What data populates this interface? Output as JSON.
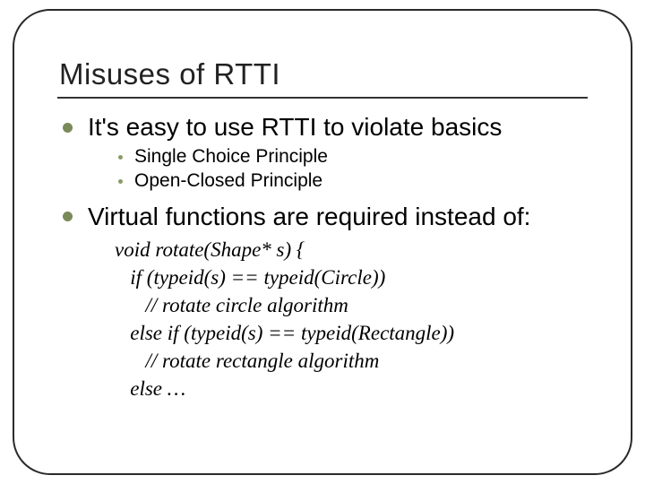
{
  "title": "Misuses of RTTI",
  "bullets": [
    {
      "text": "It's easy to use RTTI to violate basics",
      "sub": [
        "Single Choice Principle",
        "Open-Closed Principle"
      ]
    },
    {
      "text": "Virtual functions are required instead of:"
    }
  ],
  "code": "void rotate(Shape* s) {\n   if (typeid(s) == typeid(Circle))\n      // rotate circle algorithm\n   else if (typeid(s) == typeid(Rectangle))\n      // rotate rectangle algorithm\n   else …"
}
